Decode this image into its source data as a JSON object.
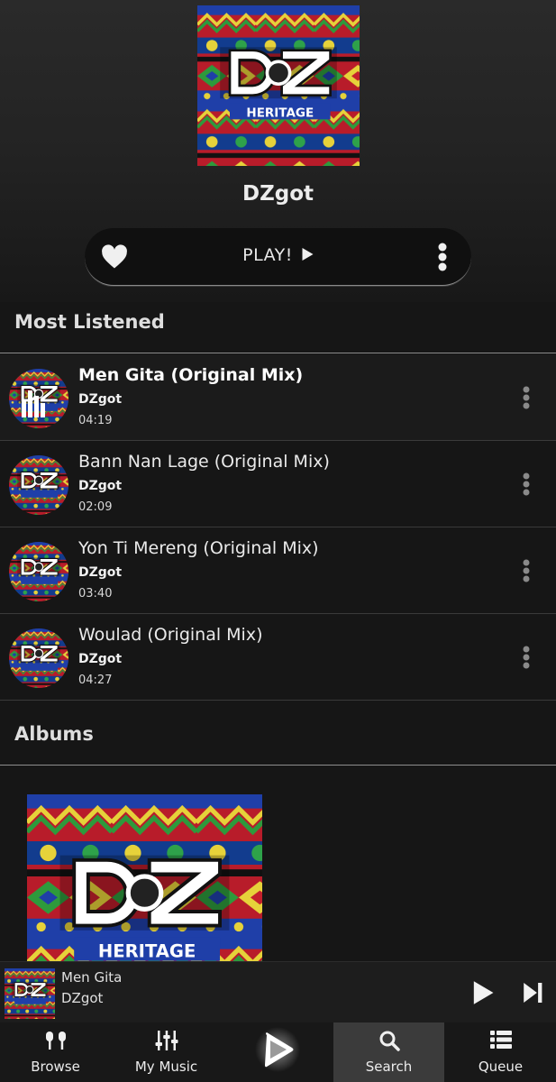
{
  "artist": {
    "name": "DZgot"
  },
  "artwork": {
    "brand_text": "DZ",
    "label_text": "HERITAGE"
  },
  "play_bar": {
    "play_label": "PLAY!",
    "favorite_icon": "heart-icon",
    "more_icon": "more-vertical-icon"
  },
  "sections": {
    "most_listened": "Most Listened",
    "albums": "Albums"
  },
  "tracks": [
    {
      "title": "Men Gita (Original Mix)",
      "artist": "DZgot",
      "duration": "04:19",
      "now_playing": true
    },
    {
      "title": "Bann Nan Lage (Original Mix)",
      "artist": "DZgot",
      "duration": "02:09",
      "now_playing": false
    },
    {
      "title": "Yon Ti Mereng (Original Mix)",
      "artist": "DZgot",
      "duration": "03:40",
      "now_playing": false
    },
    {
      "title": "Woulad (Original Mix)",
      "artist": "DZgot",
      "duration": "04:27",
      "now_playing": false
    }
  ],
  "mini_player": {
    "title": "Men Gita",
    "artist": "DZgot",
    "play_icon": "play-icon",
    "next_icon": "skip-next-icon"
  },
  "nav": {
    "items": [
      {
        "label": "Browse",
        "icon": "browse-icon"
      },
      {
        "label": "My Music",
        "icon": "equalizer-icon"
      },
      {
        "label": "",
        "icon": "app-logo-icon"
      },
      {
        "label": "Search",
        "icon": "search-icon",
        "active": true
      },
      {
        "label": "Queue",
        "icon": "queue-list-icon"
      }
    ]
  },
  "colors": {
    "background": "#161616",
    "pattern_red": "#c4202c",
    "pattern_blue": "#1d3fa6",
    "pattern_green": "#2e9a3c",
    "pattern_yellow": "#e8d43a",
    "active_tab": "#3b3b3b"
  }
}
